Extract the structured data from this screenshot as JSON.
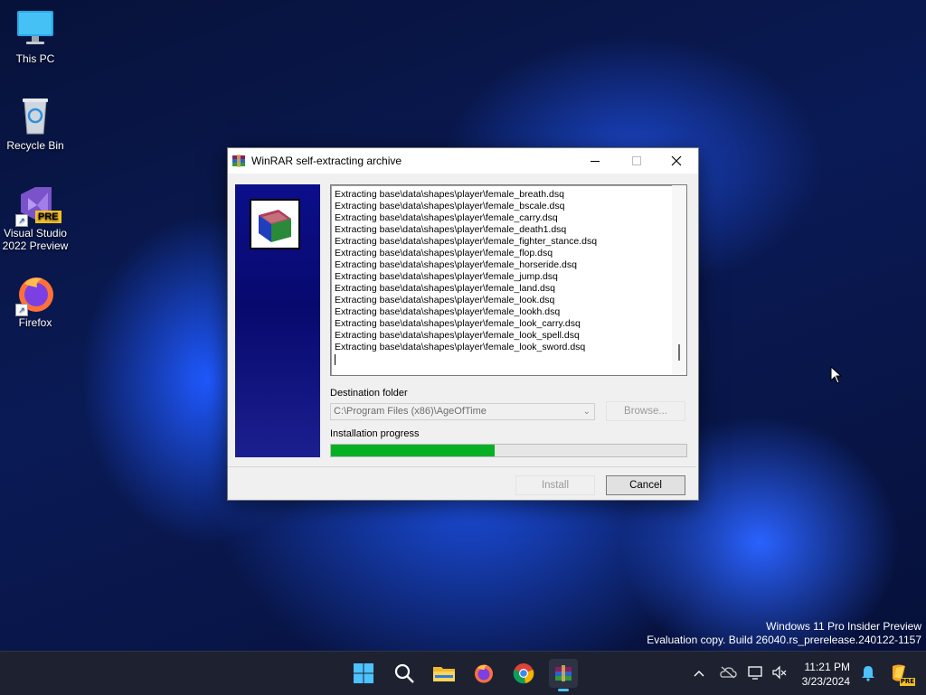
{
  "desktop": {
    "icons": [
      {
        "label": "This PC"
      },
      {
        "label": "Recycle Bin"
      },
      {
        "label": "Visual Studio 2022 Preview",
        "badge": "PRE"
      },
      {
        "label": "Firefox"
      }
    ],
    "watermark": {
      "line1": "Windows 11 Pro Insider Preview",
      "line2": "Evaluation copy. Build 26040.rs_prerelease.240122-1157"
    }
  },
  "window": {
    "title": "WinRAR self-extracting archive",
    "icons": {
      "minimize": "minimize-icon",
      "maximize": "maximize-icon",
      "close": "close-icon"
    },
    "log_lines": [
      "Extracting base\\data\\shapes\\player\\female_breath.dsq",
      "Extracting base\\data\\shapes\\player\\female_bscale.dsq",
      "Extracting base\\data\\shapes\\player\\female_carry.dsq",
      "Extracting base\\data\\shapes\\player\\female_death1.dsq",
      "Extracting base\\data\\shapes\\player\\female_fighter_stance.dsq",
      "Extracting base\\data\\shapes\\player\\female_flop.dsq",
      "Extracting base\\data\\shapes\\player\\female_horseride.dsq",
      "Extracting base\\data\\shapes\\player\\female_jump.dsq",
      "Extracting base\\data\\shapes\\player\\female_land.dsq",
      "Extracting base\\data\\shapes\\player\\female_look.dsq",
      "Extracting base\\data\\shapes\\player\\female_lookh.dsq",
      "Extracting base\\data\\shapes\\player\\female_look_carry.dsq",
      "Extracting base\\data\\shapes\\player\\female_look_spell.dsq",
      "Extracting base\\data\\shapes\\player\\female_look_sword.dsq"
    ],
    "destination_label": "Destination folder",
    "destination_value": "C:\\Program Files (x86)\\AgeOfTime",
    "browse_label": "Browse...",
    "progress_label": "Installation progress",
    "progress_fraction": 0.46,
    "progress_color": "#06b025",
    "install_label": "Install",
    "cancel_label": "Cancel"
  },
  "taskbar": {
    "items": [
      "start-icon",
      "search-icon",
      "file-explorer-icon",
      "firefox-icon",
      "chrome-icon",
      "winrar-icon"
    ],
    "tray_icons": [
      "chevron-up-icon",
      "onedrive-icon",
      "network-icon",
      "volume-muted-icon",
      "notification-bell-icon",
      "copilot-icon"
    ],
    "copilot_badge": "PRE",
    "time": "11:21 PM",
    "date": "3/23/2024"
  }
}
